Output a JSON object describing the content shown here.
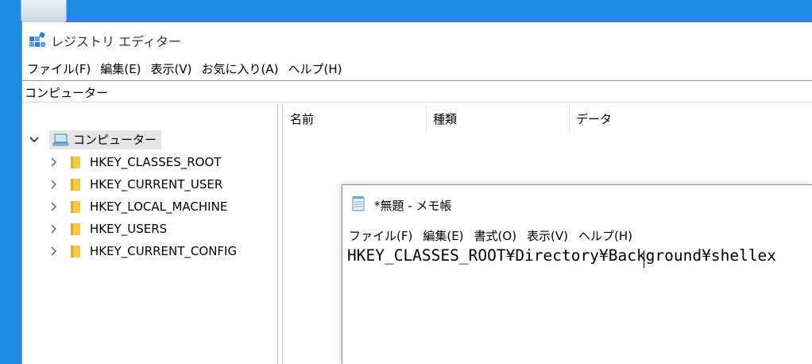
{
  "regedit": {
    "title": "レジストリ エディター",
    "menu": [
      "ファイル(F)",
      "編集(E)",
      "表示(V)",
      "お気に入り(A)",
      "ヘルプ(H)"
    ],
    "address": "コンピューター",
    "tree": {
      "root": "コンピューター",
      "keys": [
        "HKEY_CLASSES_ROOT",
        "HKEY_CURRENT_USER",
        "HKEY_LOCAL_MACHINE",
        "HKEY_USERS",
        "HKEY_CURRENT_CONFIG"
      ]
    },
    "columns": [
      "名前",
      "種類",
      "データ"
    ]
  },
  "notepad": {
    "title": "*無題 - メモ帳",
    "menu": [
      "ファイル(F)",
      "編集(E)",
      "書式(O)",
      "表示(V)",
      "ヘルプ(H)"
    ],
    "text": "HKEY_CLASSES_ROOT¥Directory¥Background¥shellex"
  },
  "icons": {
    "regedit_app": "regedit-icon",
    "computer": "computer-icon",
    "folder": "folder-icon",
    "expand": "chevron-right-icon",
    "collapse": "chevron-down-icon",
    "notepad_app": "notepad-icon"
  },
  "colors": {
    "desktop": "#1e8ae0",
    "folder": "#f5c84c",
    "selection": "#e5e5e5"
  }
}
